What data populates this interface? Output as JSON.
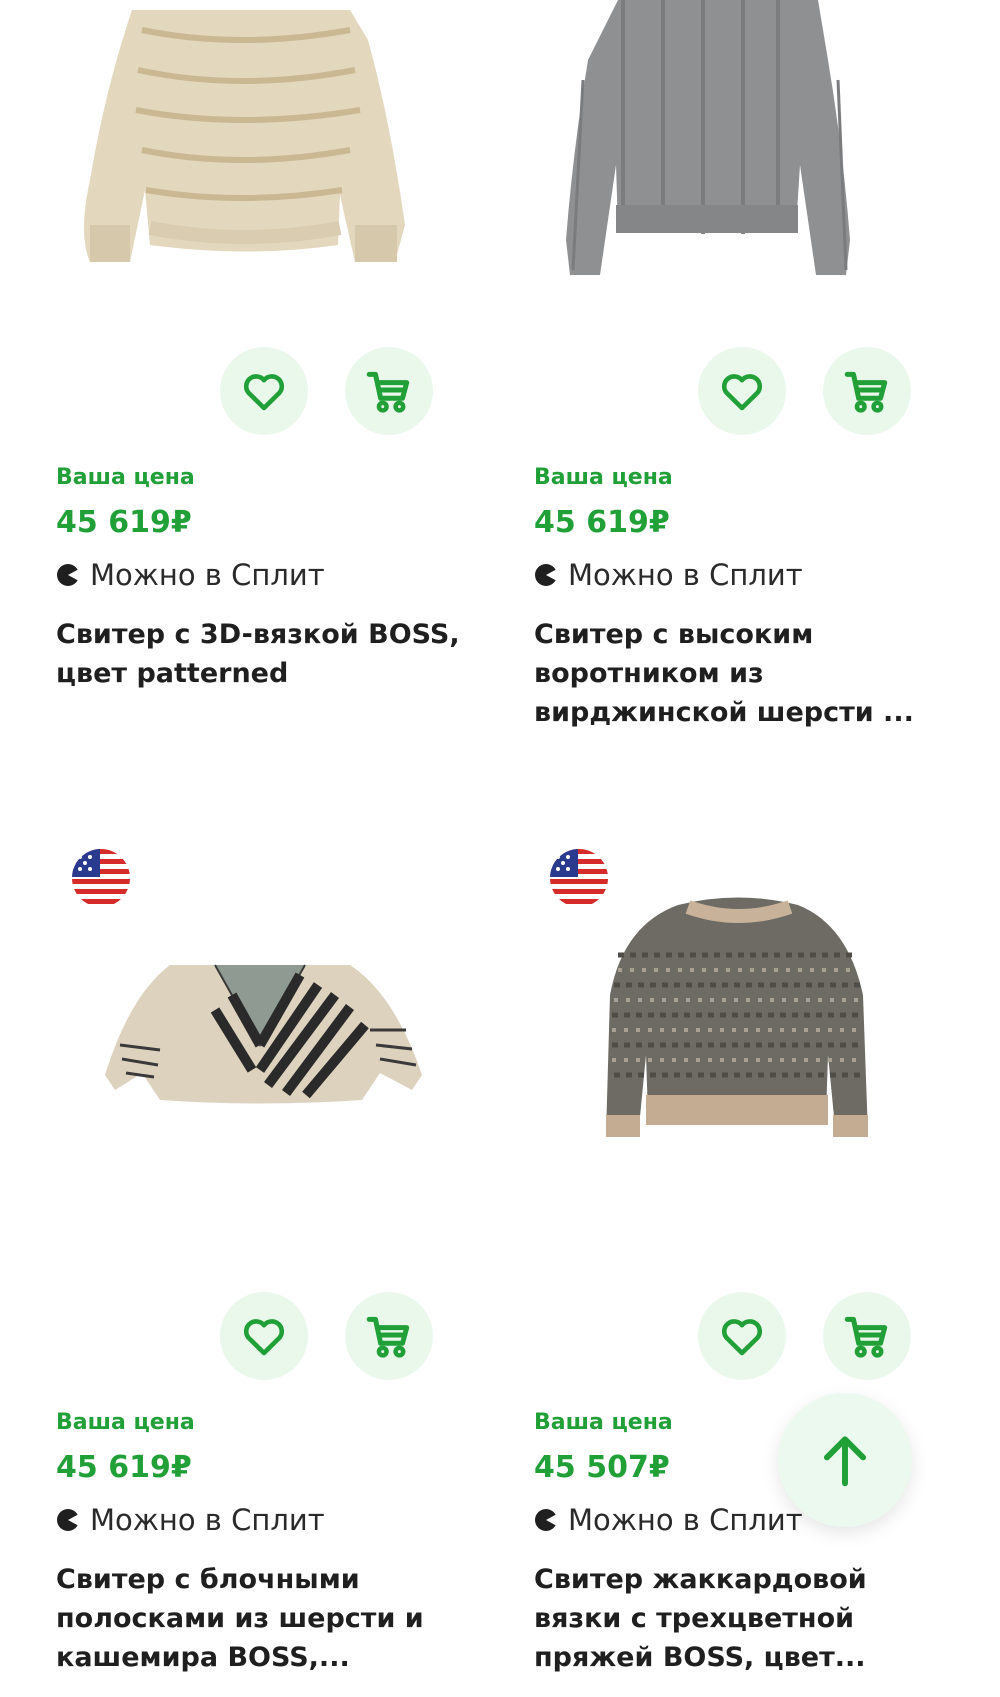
{
  "colors": {
    "accent": "#21a038",
    "button_bg": "#eaf8ec"
  },
  "products": [
    {
      "price_label": "Ваша цена",
      "price": "45 619₽",
      "split": "Можно в Сплит",
      "title": "Свитер с 3D-вязкой BOSS, цвет patterned",
      "origin_flag": "",
      "image": "beige-melange-sweater"
    },
    {
      "price_label": "Ваша цена",
      "price": "45 619₽",
      "split": "Можно в Сплит",
      "title": "Свитер с высоким воротником из вирджинской шерсти ...",
      "origin_flag": "",
      "image": "grey-ribbed-sweater"
    },
    {
      "price_label": "Ваша цена",
      "price": "45 619₽",
      "split": "Можно в Сплит",
      "title": "Свитер с блочными полосками из шерсти и кашемира BOSS,...",
      "origin_flag": "us-flag-icon",
      "image": "beige-striped-v-neck-sweater"
    },
    {
      "price_label": "Ваша цена",
      "price": "45 507₽",
      "split": "Можно в Сплит",
      "title": "Свитер жаккардовой вязки с трехцветной пряжей BOSS, цвет...",
      "origin_flag": "us-flag-icon",
      "image": "tweed-jacquard-sweater"
    }
  ],
  "icons": {
    "favorite": "heart-icon",
    "cart": "cart-icon",
    "split": "split-icon",
    "scroll_up": "arrow-up-icon"
  }
}
